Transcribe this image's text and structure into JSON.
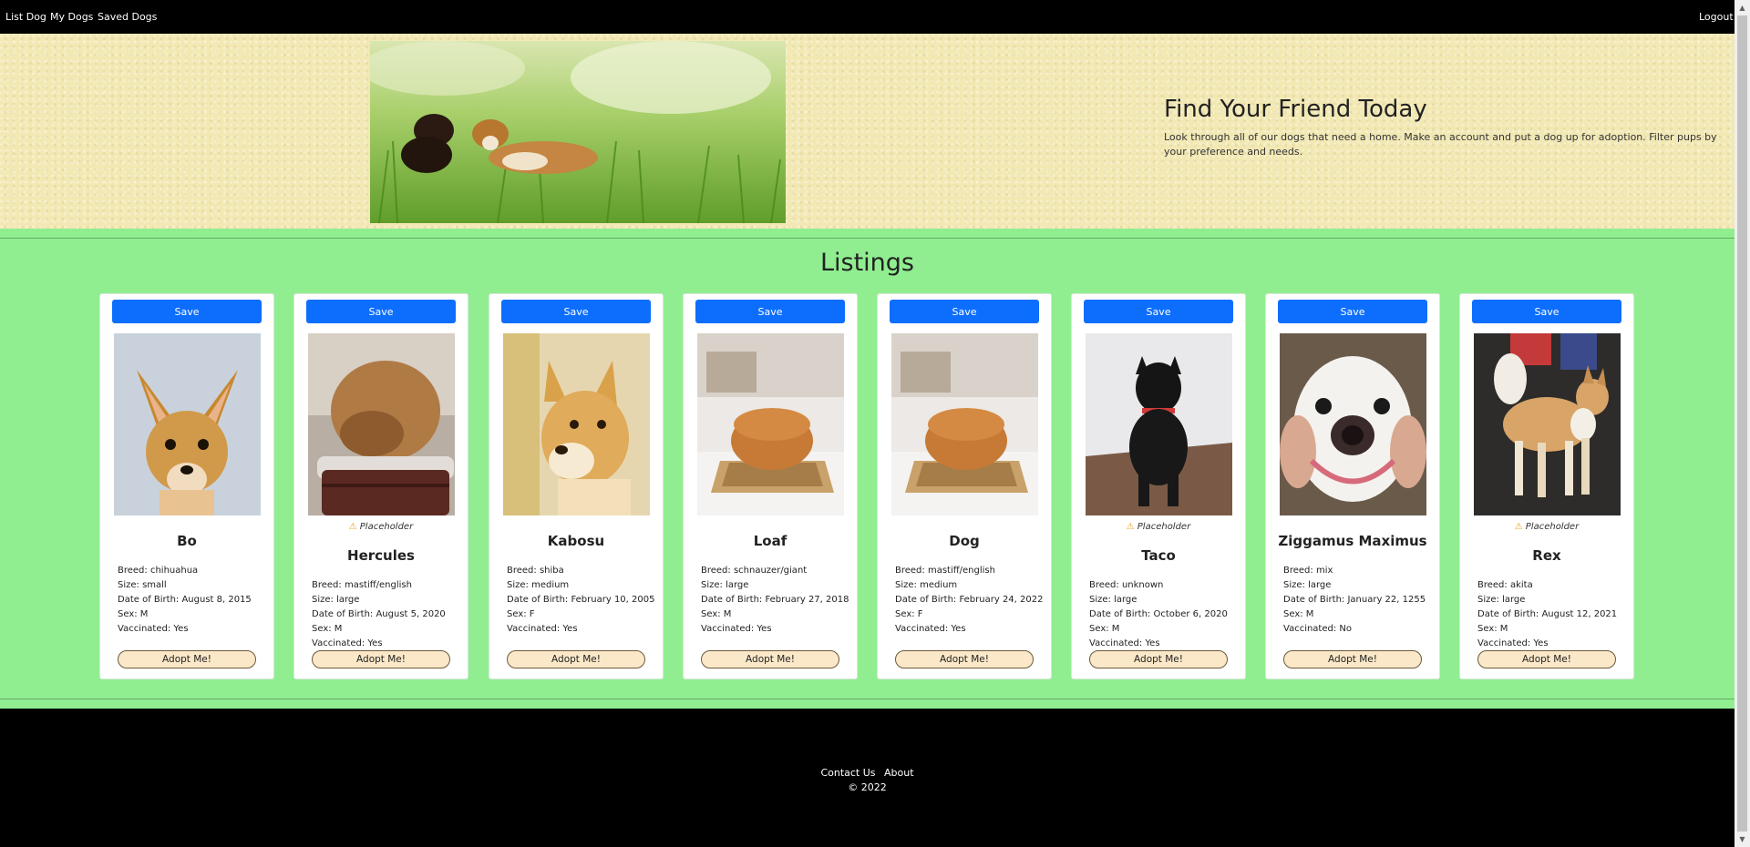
{
  "nav": {
    "list_dog": "List Dog",
    "my_dogs": "My Dogs",
    "saved_dogs": "Saved Dogs",
    "logout": "Logout"
  },
  "hero": {
    "title": "Find Your Friend Today",
    "text": "Look through all of our dogs that need a home. Make an account and put a dog up for adoption. Filter pups by your preference and needs."
  },
  "listings": {
    "title": "Listings",
    "save_label": "Save",
    "adopt_label": "Adopt Me!",
    "placeholder_label": "Placeholder",
    "dogs": [
      {
        "name": "Bo",
        "breed": "Breed: chihuahua",
        "size": "Size: small",
        "dob": "Date of Birth: August 8, 2015",
        "sex": "Sex: M",
        "vaccinated": "Vaccinated: Yes"
      },
      {
        "name": "Hercules",
        "breed": "Breed: mastiff/english",
        "size": "Size: large",
        "dob": "Date of Birth: August 5, 2020",
        "sex": "Sex: M",
        "vaccinated": "Vaccinated: Yes"
      },
      {
        "name": "Kabosu",
        "breed": "Breed: shiba",
        "size": "Size: medium",
        "dob": "Date of Birth: February 10, 2005",
        "sex": "Sex: F",
        "vaccinated": "Vaccinated: Yes"
      },
      {
        "name": "Loaf",
        "breed": "Breed: schnauzer/giant",
        "size": "Size: large",
        "dob": "Date of Birth: February 27, 2018",
        "sex": "Sex: M",
        "vaccinated": "Vaccinated: Yes"
      },
      {
        "name": "Dog",
        "breed": "Breed: mastiff/english",
        "size": "Size: medium",
        "dob": "Date of Birth: February 24, 2022",
        "sex": "Sex: F",
        "vaccinated": "Vaccinated: Yes"
      },
      {
        "name": "Taco",
        "breed": "Breed: unknown",
        "size": "Size: large",
        "dob": "Date of Birth: October 6, 2020",
        "sex": "Sex: M",
        "vaccinated": "Vaccinated: Yes"
      },
      {
        "name": "Ziggamus Maximus",
        "breed": "Breed: mix",
        "size": "Size: large",
        "dob": "Date of Birth: January 22, 1255",
        "sex": "Sex: M",
        "vaccinated": "Vaccinated: No"
      },
      {
        "name": "Rex",
        "breed": "Breed: akita",
        "size": "Size: large",
        "dob": "Date of Birth: August 12, 2021",
        "sex": "Sex: M",
        "vaccinated": "Vaccinated: Yes"
      }
    ]
  },
  "footer": {
    "contact": "Contact Us",
    "about": "About",
    "copyright": "© 2022"
  },
  "colors": {
    "nav_bg": "#000000",
    "hero_bg": "#f2e8b3",
    "listings_bg": "#90ee90",
    "save_button": "#0d6efd",
    "adopt_button": "#fbe8c8"
  },
  "icons": {
    "placeholder": "warning-icon",
    "scroll_up": "scroll-up-arrow-icon",
    "scroll_down": "scroll-down-arrow-icon"
  }
}
